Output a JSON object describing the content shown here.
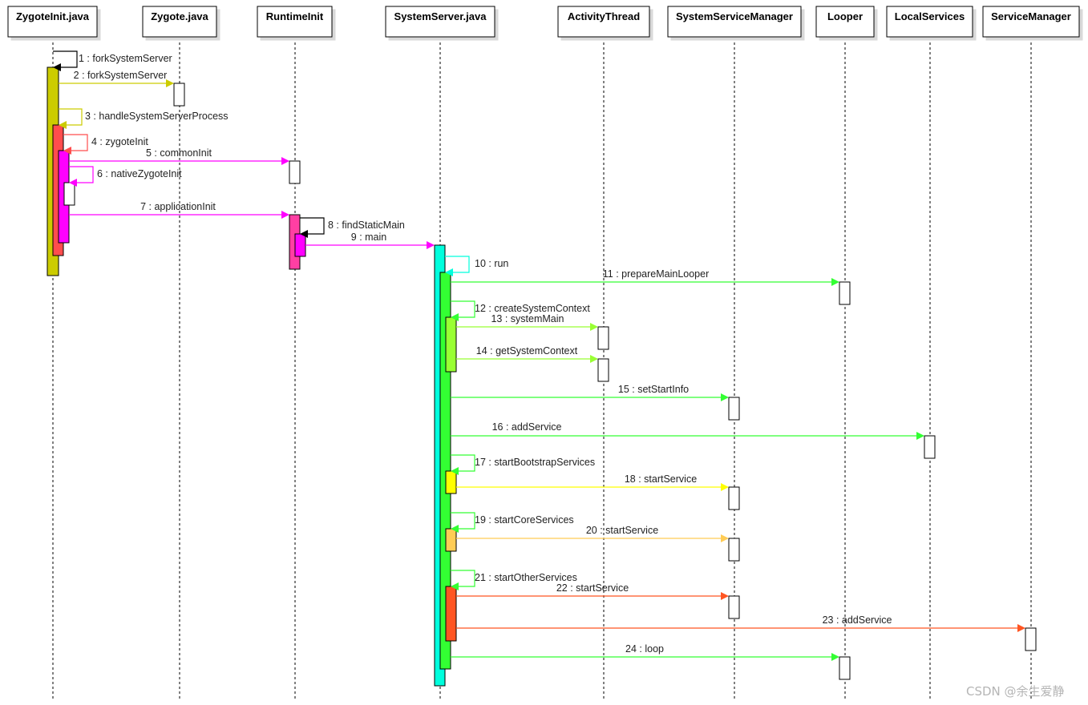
{
  "participants": [
    {
      "id": "zygoteinit",
      "label": "ZygoteInit.java"
    },
    {
      "id": "zygote",
      "label": "Zygote.java"
    },
    {
      "id": "runtimeinit",
      "label": "RuntimeInit"
    },
    {
      "id": "systemserver",
      "label": "SystemServer.java"
    },
    {
      "id": "activitythread",
      "label": "ActivityThread"
    },
    {
      "id": "systemservicemanager",
      "label": "SystemServiceManager"
    },
    {
      "id": "looper",
      "label": "Looper"
    },
    {
      "id": "localservices",
      "label": "LocalServices"
    },
    {
      "id": "servicemanager",
      "label": "ServiceManager"
    }
  ],
  "colors": {
    "olive": "#cccc00",
    "red": "#ff4d4d",
    "magenta": "#ff00ff",
    "pink": "#ff3fa3",
    "cyan": "#00ffdd",
    "green": "#33ff33",
    "lime": "#99ff33",
    "yellow": "#ffff00",
    "amber": "#ffcc55",
    "orange": "#ff5522",
    "white": "#ffffff",
    "black": "#000000"
  },
  "messages": [
    {
      "n": 1,
      "label": "1 : forkSystemServer",
      "from": "zygoteinit",
      "to": "zygoteinit",
      "self": true,
      "color": "black"
    },
    {
      "n": 2,
      "label": "2 : forkSystemServer",
      "from": "zygoteinit",
      "to": "zygote",
      "color": "olive"
    },
    {
      "n": 3,
      "label": "3 : handleSystemServerProcess",
      "from": "zygoteinit",
      "to": "zygoteinit",
      "self": true,
      "color": "olive"
    },
    {
      "n": 4,
      "label": "4 : zygoteInit",
      "from": "zygoteinit",
      "to": "zygoteinit",
      "self": true,
      "color": "red"
    },
    {
      "n": 5,
      "label": "5 : commonInit",
      "from": "zygoteinit",
      "to": "runtimeinit",
      "color": "magenta"
    },
    {
      "n": 6,
      "label": "6 : nativeZygoteInit",
      "from": "zygoteinit",
      "to": "zygoteinit",
      "self": true,
      "color": "magenta"
    },
    {
      "n": 7,
      "label": "7 : applicationInit",
      "from": "zygoteinit",
      "to": "runtimeinit",
      "color": "magenta"
    },
    {
      "n": 8,
      "label": "8 : findStaticMain",
      "from": "runtimeinit",
      "to": "runtimeinit",
      "self": true,
      "color": "black"
    },
    {
      "n": 9,
      "label": "9 : main",
      "from": "runtimeinit",
      "to": "systemserver",
      "color": "magenta"
    },
    {
      "n": 10,
      "label": "10 : run",
      "from": "systemserver",
      "to": "systemserver",
      "self": true,
      "color": "cyan"
    },
    {
      "n": 11,
      "label": "11 : prepareMainLooper",
      "from": "systemserver",
      "to": "looper",
      "color": "green"
    },
    {
      "n": 12,
      "label": "12 : createSystemContext",
      "from": "systemserver",
      "to": "systemserver",
      "self": true,
      "color": "green"
    },
    {
      "n": 13,
      "label": "13 : systemMain",
      "from": "systemserver",
      "to": "activitythread",
      "color": "lime"
    },
    {
      "n": 14,
      "label": "14 : getSystemContext",
      "from": "systemserver",
      "to": "activitythread",
      "color": "lime"
    },
    {
      "n": 15,
      "label": "15 : setStartInfo",
      "from": "systemserver",
      "to": "systemservicemanager",
      "color": "green"
    },
    {
      "n": 16,
      "label": "16 : addService",
      "from": "systemserver",
      "to": "localservices",
      "color": "green"
    },
    {
      "n": 17,
      "label": "17 : startBootstrapServices",
      "from": "systemserver",
      "to": "systemserver",
      "self": true,
      "color": "green"
    },
    {
      "n": 18,
      "label": "18 : startService",
      "from": "systemserver",
      "to": "systemservicemanager",
      "color": "yellow"
    },
    {
      "n": 19,
      "label": "19 : startCoreServices",
      "from": "systemserver",
      "to": "systemserver",
      "self": true,
      "color": "green"
    },
    {
      "n": 20,
      "label": "20 : startService",
      "from": "systemserver",
      "to": "systemservicemanager",
      "color": "amber"
    },
    {
      "n": 21,
      "label": "21 : startOtherServices",
      "from": "systemserver",
      "to": "systemserver",
      "self": true,
      "color": "green"
    },
    {
      "n": 22,
      "label": "22 : startService",
      "from": "systemserver",
      "to": "systemservicemanager",
      "color": "orange"
    },
    {
      "n": 23,
      "label": "23 : addService",
      "from": "systemserver",
      "to": "servicemanager",
      "color": "orange"
    },
    {
      "n": 24,
      "label": "24 : loop",
      "from": "systemserver",
      "to": "looper",
      "color": "green"
    }
  ],
  "watermark": "CSDN @余生爱静"
}
